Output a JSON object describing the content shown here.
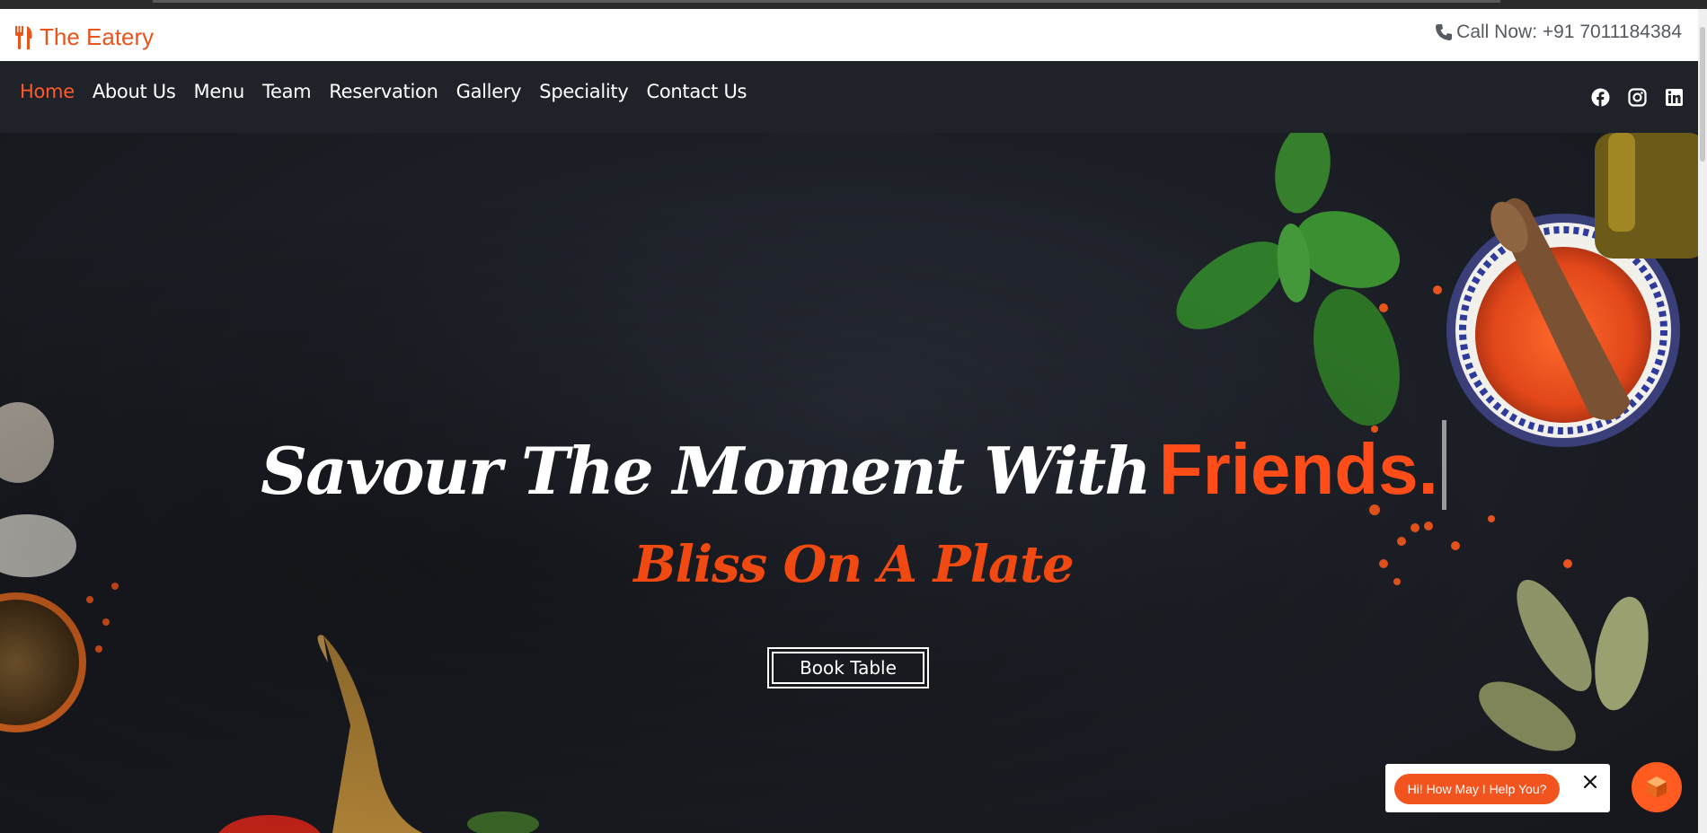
{
  "brand": {
    "name": "The Eatery",
    "icon": "fork-knife-icon",
    "color": "#e8541c"
  },
  "contact": {
    "label": "Call Now: +91 7011184384",
    "icon": "phone-icon"
  },
  "nav": {
    "items": [
      {
        "label": "Home",
        "active": true
      },
      {
        "label": "About Us"
      },
      {
        "label": "Menu"
      },
      {
        "label": "Team"
      },
      {
        "label": "Reservation"
      },
      {
        "label": "Gallery"
      },
      {
        "label": "Speciality"
      },
      {
        "label": "Contact Us"
      }
    ],
    "active_color": "#ff5a2b"
  },
  "social": [
    "facebook-icon",
    "instagram-icon",
    "linkedin-icon"
  ],
  "hero": {
    "headline_main": "Savour The Moment With",
    "headline_accent": "Friends.",
    "tagline": "Bliss On A Plate",
    "cta_label": "Book Table",
    "accent_color": "#ff4d1a"
  },
  "chat": {
    "prompt": "Hi! How May I Help You?",
    "close_icon": "close-icon",
    "launcher_icon": "cube-icon"
  }
}
